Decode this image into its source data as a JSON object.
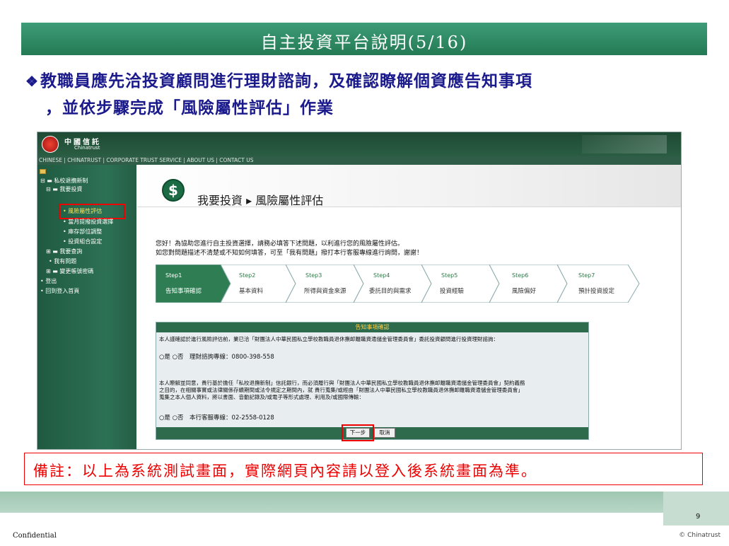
{
  "slide": {
    "title": "自主投資平台說明(5/16)",
    "heading_bullet": "❖",
    "heading_line1": "教職員應先洽投資顧問進行理財諮詢，及確認瞭解個資應告知事項",
    "heading_line2": "，並依步驟完成「風險屬性評估」作業",
    "note": "備註：以上為系統測試畫面，實際網頁內容請以登入後系統畫面為準。",
    "page_number": "9",
    "confidential": "Confidential",
    "copyright": "© Chinatrust"
  },
  "colors": {
    "title_bar": "#2f8a64",
    "heading_text": "#1a1a8c",
    "highlight": "#e00000",
    "sidebar": "#2d7155"
  },
  "app": {
    "logo_name": "中國信託",
    "logo_eng": "Chinatrust",
    "nav_links": "CHINESE | CHINATRUST | CORPORATE TRUST SERVICE | ABOUT US | CONTACT US",
    "sidebar": {
      "root": "私校退撫新制",
      "invest": "我要投資",
      "risk": "風險屬性評估",
      "monthly": "當月提撥投資選擇",
      "holdings": "庫存部位調整",
      "setting": "投資組合設定",
      "query": "我要查詢",
      "question": "我有問題",
      "password": "變更帳號密碼",
      "logout": "登出",
      "home": "回到登入首頁"
    },
    "page_title": "我要投資 ▸ 風險屬性評估",
    "intro_1": "您好！為協助您進行自主投資選擇，請務必填答下述問題，以利進行您的風險屬性評估。",
    "intro_2": "如您對問題描述不清楚或不知如何填答，可至「我有問題」撥打本行客服專線進行詢問，謝謝！",
    "steps": [
      {
        "num": "Step1",
        "label": "告知事項確認"
      },
      {
        "num": "Step2",
        "label": "基本資料"
      },
      {
        "num": "Step3",
        "label": "所得與資金來源"
      },
      {
        "num": "Step4",
        "label": "委託目的與需求"
      },
      {
        "num": "Step5",
        "label": "投資經驗"
      },
      {
        "num": "Step6",
        "label": "風險偏好"
      },
      {
        "num": "Step7",
        "label": "預計投資設定"
      }
    ],
    "form": {
      "title": "告知事項確認",
      "para1": "本人謹確認於進行風險評估前，業已洽「財團法人中華民國私立學校教職員退休撫卹離職資遣儲金管理委員會」委託投資顧問進行投資理財諮詢：",
      "q1": "○是 ○否　理財諮詢專線：0800-398-558",
      "para2_1": "本人瞭解並同意，貴行基於擔任「私校退撫新制」信託銀行，而必須履行與「財團法人中華民國私立學校教職員退休撫卹離職資遣儲金管理委員會」契約義務",
      "para2_2": "之目的，在相關事實或法律關係存續期間或法令規定之期間內，就 貴行蒐集/或經由「財團法人中華民國私立學校教職員退休撫卹離職資遣儲金管理委員會」",
      "para2_3": "蒐集之本人個人資料，將以書面、音動記錄及/或電子等形式處理、利用及/或國際傳輸：",
      "q2": "○是 ○否　本行客服專線：02-2558-0128",
      "next_button": "下一步",
      "cancel_button": "取消"
    }
  }
}
